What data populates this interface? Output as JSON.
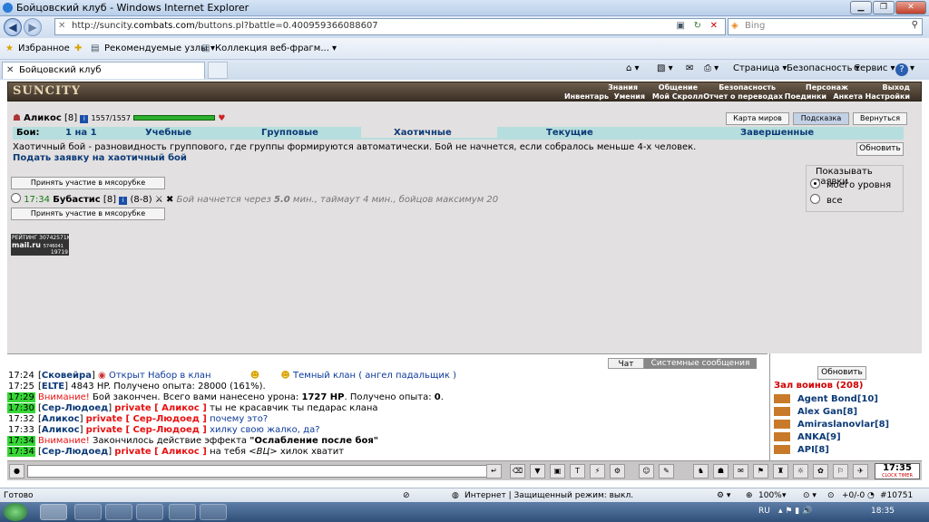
{
  "browser": {
    "title": "Бойцовский клуб - Windows Internet Explorer",
    "url_prefix": "http://suncity.",
    "url_domain": "combats.com",
    "url_suffix": "/buttons.pl?battle=0.400959366088607",
    "search_placeholder": "Bing",
    "favorites": "Избранное",
    "recommended": "Рекомендуемые узлы ▾",
    "collection": "Коллекция веб-фрагм... ▾",
    "tab_title": "Бойцовский клуб",
    "page_menu": "Страница ▾",
    "security_menu": "Безопасность ▾",
    "service_menu": "Сервис ▾",
    "help_menu": "?"
  },
  "game": {
    "logo": "SUNCITY",
    "top_menu": [
      "Знания",
      "Общение",
      "Безопасность",
      "Персонаж",
      "Выход"
    ],
    "sub_menu": [
      "Инвентарь",
      "Умения",
      "Мой Скролл",
      "Отчет о переводах",
      "Поединки",
      "Анкета",
      "Настройки"
    ],
    "character": {
      "name": "Аликос",
      "level": "[8]",
      "hp": "1557/1557"
    },
    "buttons": {
      "map": "Карта миров",
      "hint": "Подсказка",
      "back": "Вернуться",
      "refresh": "Обновить",
      "join_top": "Принять участие в мясорубке",
      "join_bottom": "Принять участие в мясорубке"
    },
    "tabs": {
      "label": "Бои:",
      "items": [
        "1 на 1",
        "Учебные",
        "Групповые",
        "Хаотичные",
        "Текущие",
        "Завершенные"
      ]
    },
    "description": "Хаотичный бой - разновидность группового, где группы формируются автоматически. Бой не начнется, если собралось меньше 4-х человек.",
    "submit_link": "Подать заявку на хаотичный бой",
    "show_requests": {
      "title": "Показывать заявки",
      "options": [
        "моего уровня",
        "все"
      ]
    },
    "battle": {
      "time": "17:34",
      "name": "Бубастис",
      "level": "[8]",
      "count": "(8-8)",
      "info_pre": "Бой начнется через ",
      "info_bold": "5.0",
      "info_post": " мин., таймаут 4 мин., бойцов максимум 20"
    },
    "rating": {
      "label": "РЕЙТИНГ",
      "n1": "30742571K",
      "brand": "mail.ru",
      "n2": "5746041",
      "n3": "19719"
    }
  },
  "chat": {
    "tabs": [
      "Чат",
      "Системные сообщения"
    ],
    "lines": [
      {
        "time": "17:24",
        "name": "Сковейра",
        "text": "Открыт Набор в клан",
        "text2": "Темный клан ( ангел падальщик )"
      },
      {
        "time": "17:25",
        "name": "ELTE",
        "text": "4843 HP. Получено опыта: 28000 (161%)."
      },
      {
        "time": "17:29",
        "prefix": "Внимание!",
        "text_a": "Бой закончен. Всего вами нанесено урона: ",
        "bold": "1727 HP",
        "text_b": ". Получено опыта: ",
        "bold2": "0",
        "text_c": "."
      },
      {
        "time": "17:30",
        "name": "Сер-Людоед",
        "private": "private [ Аликос ]",
        "text": "ты не красавчик ты педарас клана"
      },
      {
        "time": "17:32",
        "name": "Аликос",
        "private": "private [ Сер-Людоед ]",
        "text": "почему это?"
      },
      {
        "time": "17:33",
        "name": "Аликос",
        "private": "private [ Сер-Людоед ]",
        "text": "хилку свою жалко, да?"
      },
      {
        "time": "17:34",
        "prefix": "Внимание!",
        "text_a": "Закончилось действие эффекта ",
        "bold": "\"Ослабление после боя\""
      },
      {
        "time": "17:34",
        "name": "Сер-Людоед",
        "private": "private [ Аликос ]",
        "text_a": "на тебя ",
        "italic": "<ВЦ>",
        "text_b": " хилок хватит"
      }
    ],
    "refresh": "Обновить",
    "hall": "Зал воинов (208)",
    "players": [
      {
        "name": "Agent Bond",
        "level": "[10]"
      },
      {
        "name": "Alex Gan",
        "level": "[8]"
      },
      {
        "name": "Amiraslanovlar",
        "level": "[8]"
      },
      {
        "name": "ANKA",
        "level": "[9]"
      },
      {
        "name": "API",
        "level": "[8]"
      }
    ],
    "clock": "17:35",
    "clock_label": "CLOCK TIMER"
  },
  "statusbar": {
    "ready": "Готово",
    "zone": "Интернет | Защищенный режим: выкл.",
    "zoom": "100%",
    "extra": "+0/-0",
    "counter": "#10751"
  },
  "taskbar": {
    "lang": "RU",
    "time": "18:35"
  },
  "colors": {
    "accent": "#0c3a77",
    "tabs_bg": "#b6dede",
    "game_bg": "#e2e0e0",
    "alert_green": "#36d636",
    "private_red": "#e81010"
  }
}
